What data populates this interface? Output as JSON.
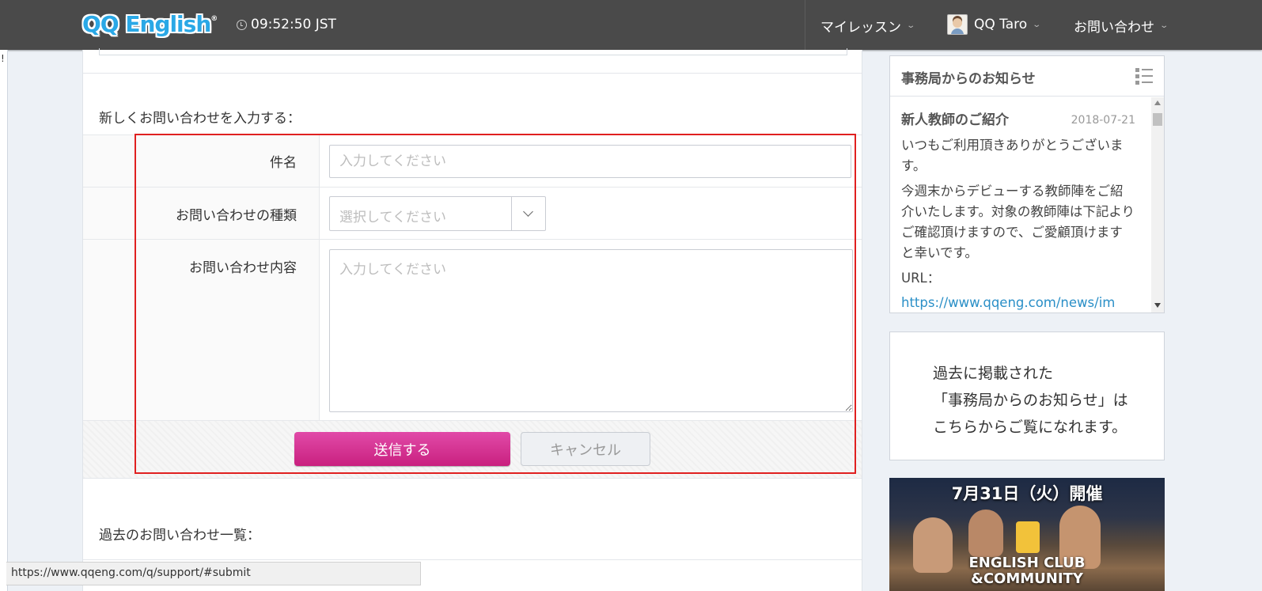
{
  "header": {
    "logo_text": "QQ English",
    "logo_mark": "®",
    "time": "09:52:50 JST",
    "nav": {
      "my_lessons": "マイレッスン",
      "user_name": "QQ Taro",
      "contact": "お問い合わせ"
    }
  },
  "left_strip_text": "!",
  "form": {
    "section_title": "新しくお問い合わせを入力する：",
    "subject_label": "件名",
    "subject_placeholder": "入力してください",
    "type_label": "お問い合わせの種類",
    "type_selected": "選択してください",
    "content_label": "お問い合わせ内容",
    "content_placeholder": "入力してください",
    "submit_label": "送信する",
    "cancel_label": "キャンセル"
  },
  "history": {
    "section_title": "過去のお問い合わせ一覧："
  },
  "news": {
    "header_title": "事務局からのお知らせ",
    "item_title": "新人教師のご紹介",
    "item_date": "2018-07-21",
    "paragraph1": "いつもご利用頂きありがとうございます。",
    "paragraph2": "今週末からデビューする教師陣をご紹介いたします。対象の教師陣は下記よりご確認頂けますので、ご愛顧頂けますと幸いです。",
    "url_label": "URL：",
    "url_link": "https://www.qqeng.com/news/im"
  },
  "archive": {
    "line1": "過去に掲載された",
    "line2": "「事務局からのお知らせ」は",
    "line3": "こちらからご覧になれます。"
  },
  "banner": {
    "title": "7月31日（火）開催",
    "bottom_line1": "ENGLISH CLUB",
    "bottom_line2": "&COMMUNITY"
  },
  "status_bar_url": "https://www.qqeng.com/q/support/#submit",
  "colors": {
    "header_bg": "#4a4a4a",
    "submit_button": "#d6338f",
    "highlight_border": "#e02020",
    "link": "#2a8fc7"
  }
}
